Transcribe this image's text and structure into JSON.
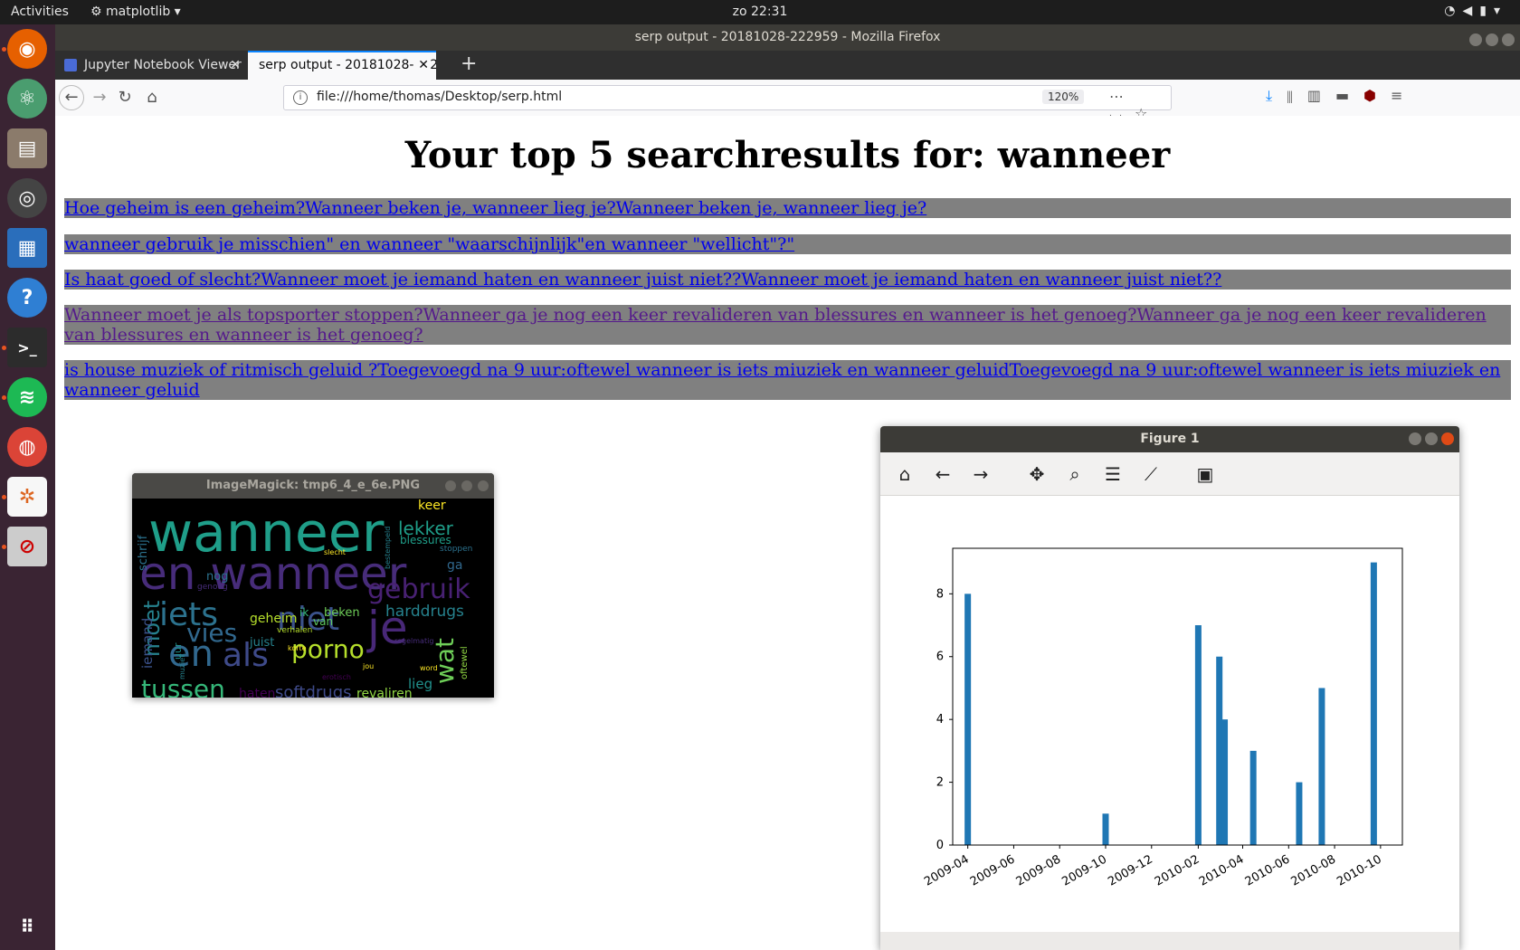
{
  "topbar": {
    "activities": "Activities",
    "app": "matplotlib",
    "clock": "zo 22:31"
  },
  "dock": {
    "items": [
      "firefox-icon",
      "atom-icon",
      "files-icon",
      "rhythmbox-icon",
      "libreoffice-impress-icon",
      "help-icon",
      "terminal-icon",
      "spotify-icon",
      "chrome-icon",
      "matplotlib-icon",
      "imagemagick-icon",
      "app-grid-icon"
    ]
  },
  "firefox": {
    "window_title": "serp output - 20181028-222959 - Mozilla Firefox",
    "tabs": [
      {
        "label": "Jupyter Notebook Viewer"
      },
      {
        "label": "serp output - 20181028-222959"
      }
    ],
    "url": "file:///home/thomas/Desktop/serp.html",
    "zoom": "120%"
  },
  "page": {
    "heading": "Your top 5 searchresults for: wanneer",
    "results": [
      "Hoe geheim is een geheim?Wanneer beken je, wanneer lieg je?Wanneer beken je, wanneer lieg je?",
      "wanneer gebruik je misschien\" en wanneer \"waarschijnlijk\"en wanneer \"wellicht\"?\"",
      "Is haat goed of slecht?Wanneer moet je iemand haten en wanneer juist niet??Wanneer moet je iemand haten en wanneer juist niet??",
      "Wanneer moet je als topsporter stoppen?Wanneer ga je nog een keer revalideren van blessures en wanneer is het genoeg?Wanneer ga je nog een keer revalideren van blessures en wanneer is het genoeg?",
      "is house muziek of ritmisch geluid ?Toegevoegd na 9 uur:oftewel wanneer is iets miuziek en wanneer geluidToegevoegd na 9 uur:oftewel wanneer is iets miuziek en wanneer geluid"
    ]
  },
  "imagemagick": {
    "title": "ImageMagick: tmp6_4_e_6e.PNG",
    "words": [
      {
        "t": "wanneer",
        "c": "#1f9e89"
      },
      {
        "t": "en wanneer",
        "c": "#472c7a"
      },
      {
        "t": "iets",
        "c": "#2c728e"
      },
      {
        "t": "niet",
        "c": "#3b528b"
      },
      {
        "t": "gebruik",
        "c": "#482173"
      },
      {
        "t": "je",
        "c": "#482878"
      },
      {
        "t": "en",
        "c": "#31688e"
      },
      {
        "t": "als",
        "c": "#3e4a89"
      },
      {
        "t": "porno",
        "c": "#b5de2b"
      },
      {
        "t": "tussen",
        "c": "#35b779"
      },
      {
        "t": "vies",
        "c": "#31688e"
      },
      {
        "t": "moet",
        "c": "#26828e"
      },
      {
        "t": "wat",
        "c": "#6ece58"
      },
      {
        "t": "lekker",
        "c": "#1f9e89"
      },
      {
        "t": "keer",
        "c": "#fde725"
      },
      {
        "t": "harddrugs",
        "c": "#26828e"
      },
      {
        "t": "softdrugs",
        "c": "#3e4a89"
      },
      {
        "t": "revaliren",
        "c": "#90d743"
      },
      {
        "t": "haten",
        "c": "#440154"
      },
      {
        "t": "lieg",
        "c": "#21918c"
      },
      {
        "t": "geheim",
        "c": "#b5de2b"
      },
      {
        "t": "juist",
        "c": "#26828e"
      },
      {
        "t": "beken",
        "c": "#6ece58"
      },
      {
        "t": "nog",
        "c": "#2c728e"
      },
      {
        "t": "iemand",
        "c": "#3b528b"
      },
      {
        "t": "blessures",
        "c": "#1f9e89"
      },
      {
        "t": "schrijf",
        "c": "#2c728e"
      },
      {
        "t": "ga",
        "c": "#31688e"
      },
      {
        "t": "uur",
        "c": "#21918c"
      },
      {
        "t": "ik",
        "c": "#35b779"
      },
      {
        "t": "van",
        "c": "#5ec962"
      },
      {
        "t": "verhalen",
        "c": "#b5de2b"
      },
      {
        "t": "korte",
        "c": "#fde725"
      },
      {
        "t": "oftewel",
        "c": "#90d743"
      },
      {
        "t": "regelmatig",
        "c": "#472c7a"
      },
      {
        "t": "stoppen",
        "c": "#2c728e"
      },
      {
        "t": "bestempeld",
        "c": "#26828e"
      },
      {
        "t": "erotisch",
        "c": "#440154"
      },
      {
        "t": "genoeg",
        "c": "#472c7a"
      },
      {
        "t": "slecht",
        "c": "#fde725"
      },
      {
        "t": "word",
        "c": "#fde725"
      },
      {
        "t": "muziek",
        "c": "#26828e"
      },
      {
        "t": "wilverschil",
        "c": "#21918c"
      },
      {
        "t": "jou",
        "c": "#fde725"
      }
    ]
  },
  "figure": {
    "title": "Figure 1",
    "toolbar": [
      "home-icon",
      "back-icon",
      "forward-icon",
      "pan-icon",
      "zoom-icon",
      "subplots-icon",
      "customize-icon",
      "save-icon"
    ]
  },
  "chart_data": {
    "type": "bar",
    "title": "",
    "xlabel": "",
    "ylabel": "",
    "bar_color": "#1f77b4",
    "x_ticks": [
      "2009-04",
      "2009-06",
      "2009-08",
      "2009-10",
      "2009-12",
      "2010-02",
      "2010-04",
      "2010-06",
      "2010-08",
      "2010-10"
    ],
    "y_ticks": [
      0,
      2,
      4,
      6,
      8
    ],
    "ylim": [
      0,
      9.45
    ],
    "xlim": [
      "2009-03-12",
      "2010-10-30"
    ],
    "points": [
      {
        "x": "2009-04-01",
        "y": 8
      },
      {
        "x": "2009-10-01",
        "y": 1
      },
      {
        "x": "2010-02-01",
        "y": 7
      },
      {
        "x": "2010-03-01",
        "y": 6
      },
      {
        "x": "2010-03-08",
        "y": 4
      },
      {
        "x": "2010-04-15",
        "y": 3
      },
      {
        "x": "2010-06-15",
        "y": 2
      },
      {
        "x": "2010-07-15",
        "y": 5
      },
      {
        "x": "2010-09-22",
        "y": 9
      }
    ],
    "grid": false,
    "legend": false
  }
}
